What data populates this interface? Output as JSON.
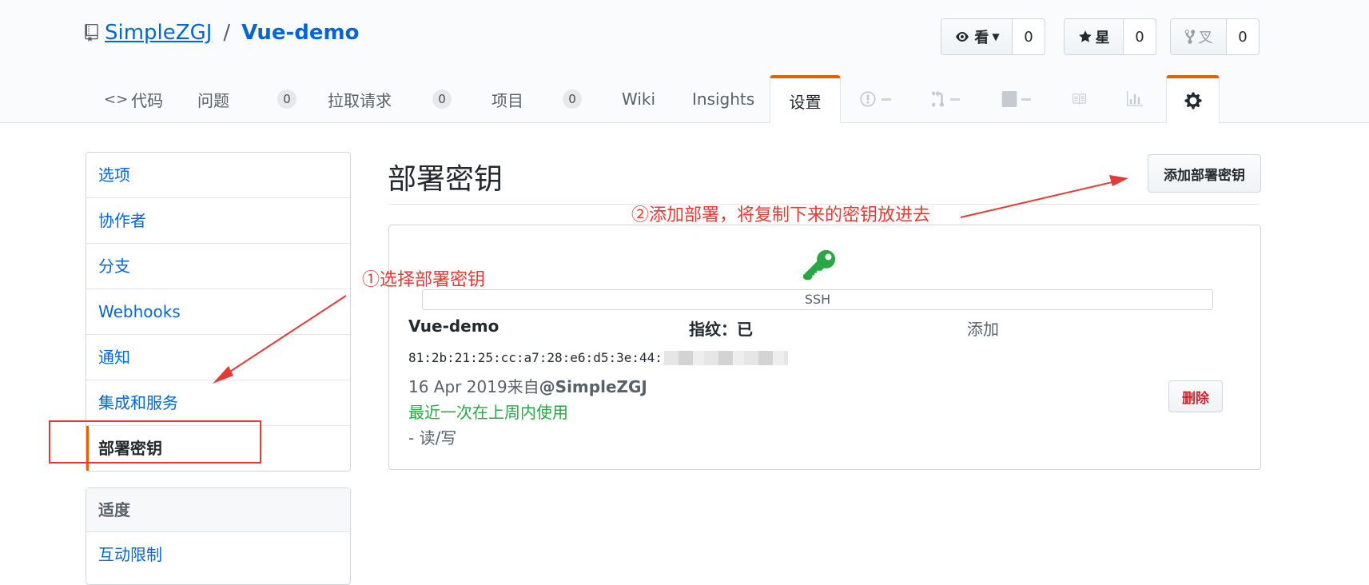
{
  "repo": {
    "owner": "SimpleZGJ",
    "separator": "/",
    "name": "Vue-demo"
  },
  "actions": {
    "watch": {
      "label": "看",
      "count": "0"
    },
    "star": {
      "label": "星",
      "count": "0"
    },
    "fork": {
      "label": "叉",
      "count": "0"
    }
  },
  "tabs": {
    "code": "代码",
    "issues": {
      "label": "问题",
      "count": "0"
    },
    "pulls": {
      "label": "拉取请求",
      "count": "0"
    },
    "projects": {
      "label": "项目",
      "count": "0"
    },
    "wiki": "Wiki",
    "insights": "Insights",
    "settings": "设置"
  },
  "sidebar": {
    "items": [
      "选项",
      "协作者",
      "分支",
      "Webhooks",
      "通知",
      "集成和服务",
      "部署密钥"
    ],
    "section2": {
      "heading": "适度",
      "items": [
        "互动限制"
      ]
    }
  },
  "main": {
    "heading": "部署密钥",
    "add_button": "添加部署密钥",
    "key": {
      "type_label": "SSH",
      "title": "Vue-demo",
      "fingerprint_label": "指纹：已",
      "added_label": "添加",
      "fingerprint": "81:2b:21:25:cc:a7:28:e6:d5:3e:44:",
      "date_prefix": "16 Apr 2019来自",
      "date_user": "@SimpleZGJ",
      "recent": "最近一次在上周内使用",
      "access": "- 读/写",
      "delete_button": "删除"
    }
  },
  "annotations": {
    "step1": "①选择部署密钥",
    "step2": "②添加部署，将复制下来的密钥放进去"
  },
  "colors": {
    "link": "#0366d6",
    "accent_orange": "#e36209",
    "success_green": "#28a745",
    "danger_red": "#cb2431",
    "annotation_red": "#e53935"
  },
  "icons": [
    "repo-icon",
    "eye-icon",
    "star-icon",
    "fork-icon",
    "code-icon",
    "issue-icon",
    "pr-icon",
    "project-icon",
    "wiki-icon",
    "graph-icon",
    "gear-icon",
    "key-icon"
  ]
}
